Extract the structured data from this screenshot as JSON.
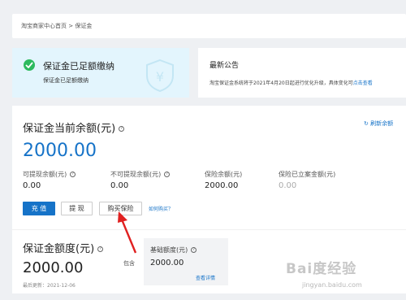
{
  "breadcrumb": "淘宝商家中心首页 > 保证金",
  "status": {
    "title": "保证金已足额缴纳",
    "subtitle": "保证金已足额缴纳",
    "shield_glyph": "¥"
  },
  "notice": {
    "title": "最新公告",
    "text": "淘宝保证金系统将于2021年4月20日起进行优化升级，具体变化可",
    "link": "点击查看"
  },
  "balance": {
    "title": "保证金当前余额(元)",
    "refresh": "刷新余额",
    "amount": "2000.00",
    "metrics": [
      {
        "label": "可提现余额(元)",
        "value": "0.00"
      },
      {
        "label": "不可提现余额(元)",
        "value": "0.00"
      },
      {
        "label": "保险余额(元)",
        "value": "2000.00"
      },
      {
        "label": "保险已立案金额(元)",
        "value": "0.00"
      }
    ],
    "buttons": {
      "recharge": "充 值",
      "withdraw": "提 现",
      "buy_insurance": "购买保险"
    },
    "how_to_buy": "如何购买？"
  },
  "quota": {
    "title": "保证金额度(元)",
    "amount": "2000.00",
    "updated": "最后更新：2021-12-06",
    "includes": "包含",
    "base_label": "基础额度(元)",
    "base_value": "2000.00",
    "details_link": "查看详情"
  },
  "watermark": {
    "main": "Bai度经验",
    "sub": "jingyan.baidu.com"
  },
  "colors": {
    "accent": "#1673c8",
    "success": "#2dba5e",
    "status_bg": "#e3f5fd",
    "arrow": "#e02020"
  }
}
